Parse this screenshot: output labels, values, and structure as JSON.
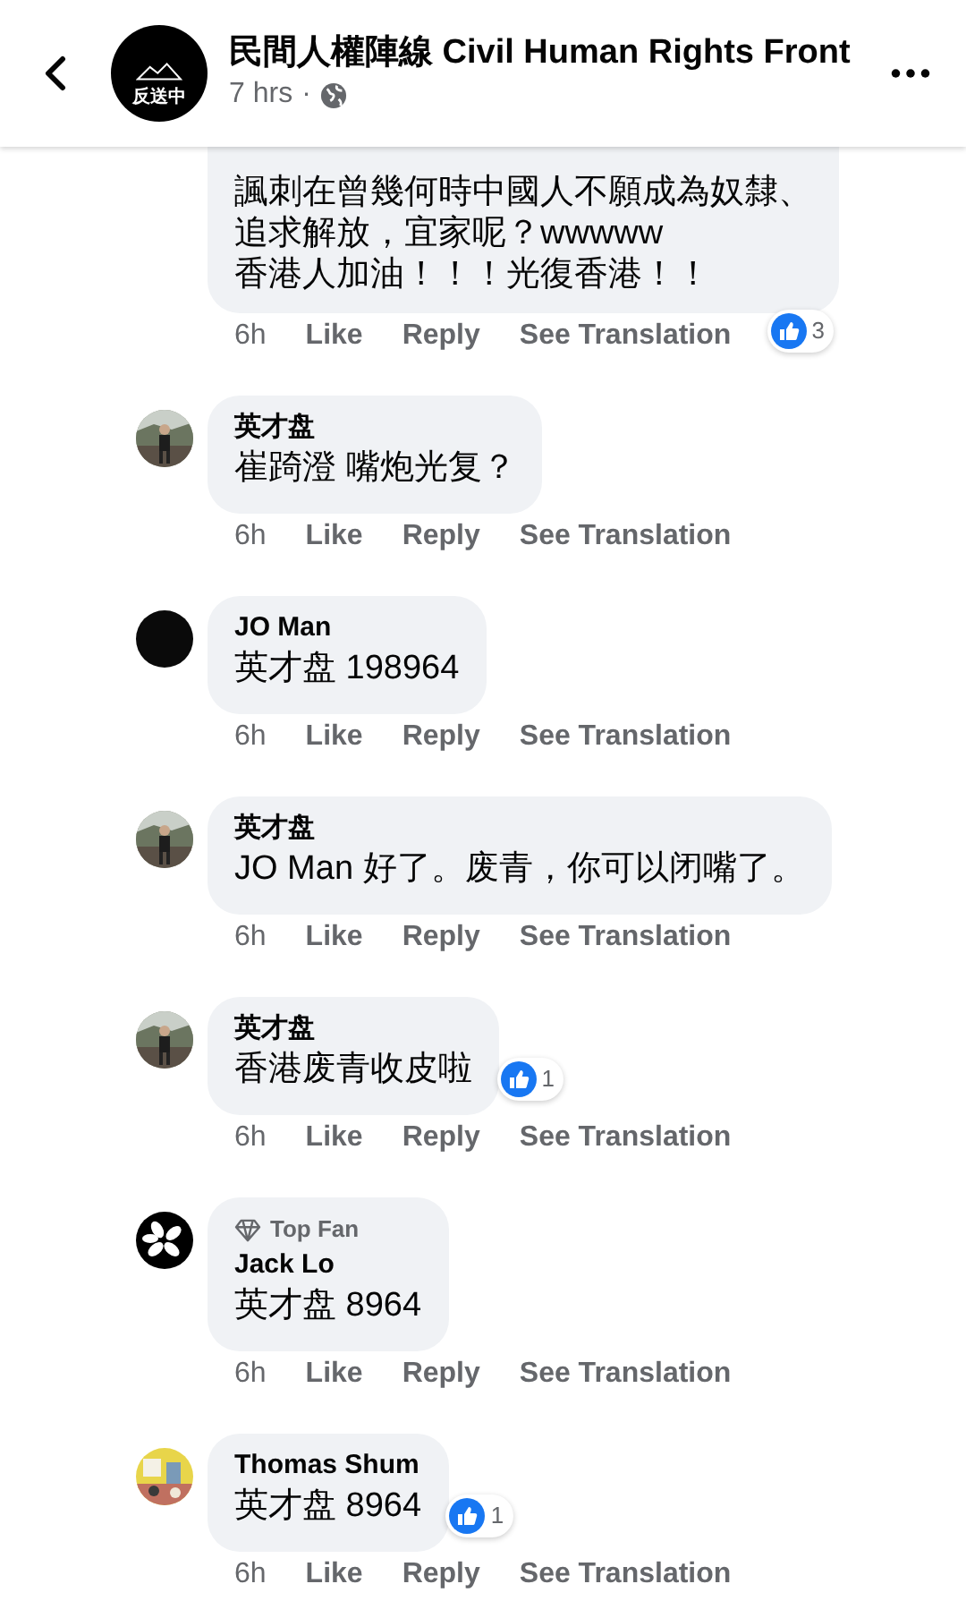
{
  "header": {
    "page_name": "民間人權陣線 Civil Human Rights Front",
    "time": "7 hrs",
    "separator": "·",
    "avatar_text": "反送中"
  },
  "comments": [
    {
      "top_fan": false,
      "lines": [
        "諷刺在曾幾何時中國人不願成為奴隸、",
        "追求解放，宜家呢？wwwww",
        "香港人加油！！！光復香港！！"
      ],
      "reactions": "3",
      "time": "6h",
      "actions": [
        "Like",
        "Reply",
        "See Translation"
      ]
    },
    {
      "name": "英才盘",
      "top_fan": false,
      "lines": [
        "崔踦澄 嘴炮光复？"
      ],
      "time": "6h",
      "actions": [
        "Like",
        "Reply",
        "See Translation"
      ]
    },
    {
      "avatar": {
        "kind": "dark"
      },
      "name": "JO Man",
      "top_fan": false,
      "lines": [
        "英才盘 198964"
      ],
      "time": "6h",
      "actions": [
        "Like",
        "Reply",
        "See Translation"
      ]
    },
    {
      "name": "英才盘",
      "top_fan": false,
      "lines": [
        "JO Man 好了。废青，你可以闭嘴了。"
      ],
      "time": "6h",
      "actions": [
        "Like",
        "Reply",
        "See Translation"
      ]
    },
    {
      "name": "英才盘",
      "top_fan": false,
      "lines": [
        "香港废青收皮啦"
      ],
      "reactions": "1",
      "time": "6h",
      "actions": [
        "Like",
        "Reply",
        "See Translation"
      ]
    },
    {
      "avatar": {
        "kind": "flower"
      },
      "name": "Jack Lo",
      "top_fan": true,
      "badge_label": "Top Fan",
      "lines": [
        "英才盘 8964"
      ],
      "time": "6h",
      "actions": [
        "Like",
        "Reply",
        "See Translation"
      ]
    },
    {
      "avatar": {
        "kind": "illustration"
      },
      "name": "Thomas Shum",
      "top_fan": false,
      "lines": [
        "英才盘 8964"
      ],
      "reactions": "1",
      "time": "6h",
      "actions": [
        "Like",
        "Reply",
        "See Translation"
      ]
    }
  ]
}
